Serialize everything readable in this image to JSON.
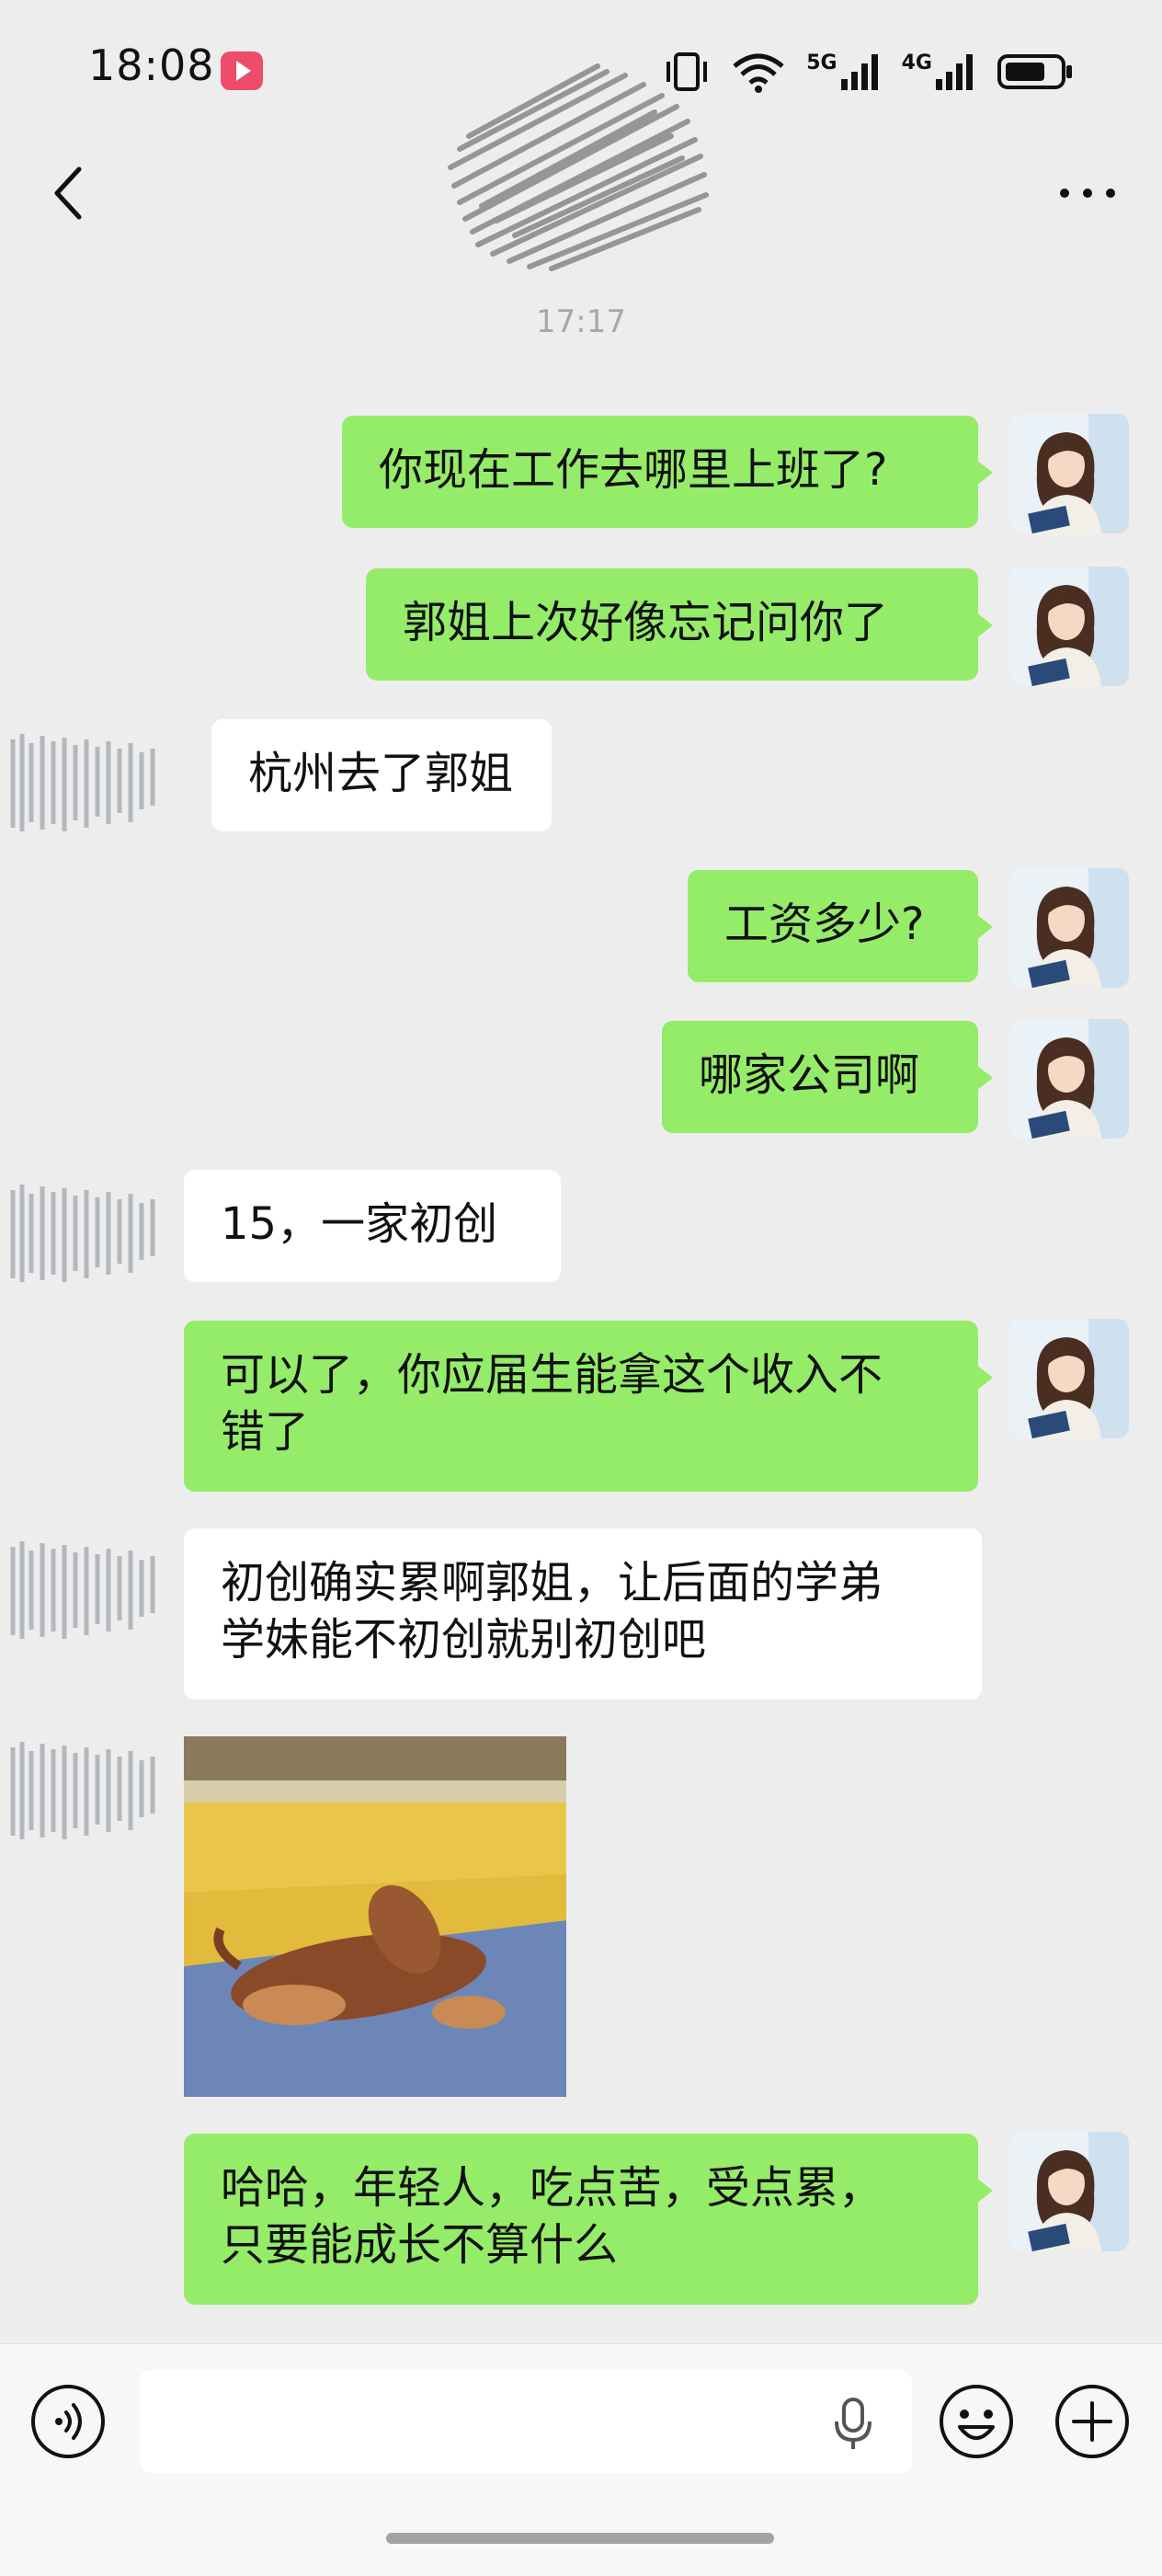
{
  "status_bar": {
    "time": "18:08",
    "network_1": "5G",
    "network_2": "4G",
    "icons": [
      "vibrate-icon",
      "wifi-icon",
      "signal-5g-icon",
      "signal-4g-icon",
      "battery-icon"
    ]
  },
  "header": {
    "back_icon": "chevron-left-icon",
    "more_icon": "more-dots-icon"
  },
  "timestamp": "17:17",
  "messages": [
    {
      "from": "me",
      "text": "你现在工作去哪里上班了?"
    },
    {
      "from": "me",
      "text": "郭姐上次好像忘记问你了"
    },
    {
      "from": "other",
      "text": "杭州去了郭姐"
    },
    {
      "from": "me",
      "text": "工资多少?"
    },
    {
      "from": "me",
      "text": "哪家公司啊"
    },
    {
      "from": "other",
      "text": "15，一家初创"
    },
    {
      "from": "me",
      "text": "可以了，你应届生能拿这个收入不\n错了"
    },
    {
      "from": "other",
      "text": "初创确实累啊郭姐，让后面的学弟\n学妹能不初创就别初创吧"
    },
    {
      "from": "other",
      "type": "sticker"
    },
    {
      "from": "me",
      "text": "哈哈，年轻人，吃点苦，受点累，\n只要能成长不算什么"
    }
  ],
  "input_bar": {
    "text_value": "",
    "icons": [
      "voice-icon",
      "mic-icon",
      "emoji-icon",
      "plus-icon"
    ]
  },
  "colors": {
    "background": "#ededed",
    "outgoing_bubble": "#95ec69",
    "incoming_bubble": "#ffffff"
  }
}
